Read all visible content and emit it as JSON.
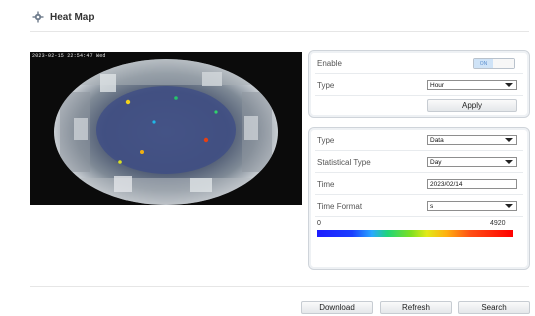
{
  "header": {
    "title": "Heat Map",
    "icon": "heatmap-icon"
  },
  "video": {
    "osd_text": "2023-02-15 22:54:47 Wed"
  },
  "settings": {
    "enable_label": "Enable",
    "enable_toggle_text": "ON",
    "type_label": "Type",
    "type_value": "Hour",
    "apply_label": "Apply"
  },
  "query": {
    "type_label": "Type",
    "type_value": "Data",
    "statistical_type_label": "Statistical Type",
    "statistical_type_value": "Day",
    "time_label": "Time",
    "time_value": "2023/02/14",
    "time_format_label": "Time Format",
    "time_format_value": "s",
    "scale_min": "0",
    "scale_max": "4920"
  },
  "actions": {
    "download_label": "Download",
    "refresh_label": "Refresh",
    "search_label": "Search"
  }
}
